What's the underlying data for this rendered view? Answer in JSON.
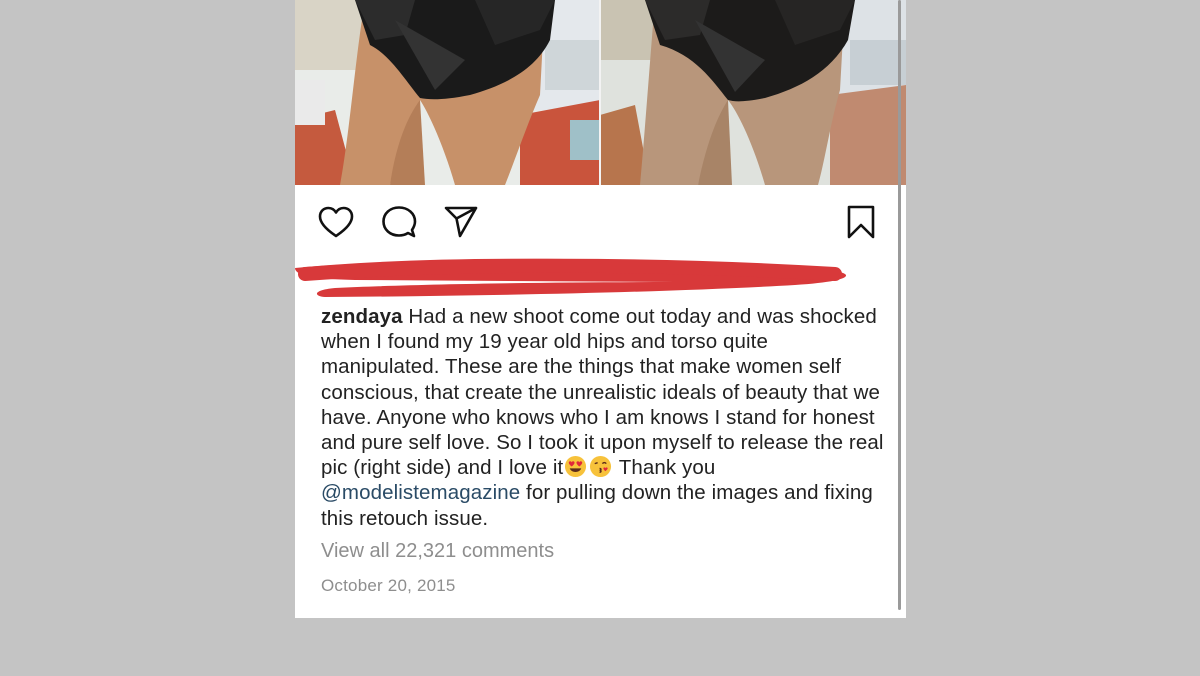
{
  "post": {
    "images": [
      {
        "icon": "edited-photo-image"
      },
      {
        "icon": "original-photo-image"
      }
    ],
    "actions": {
      "like_icon": "heart-icon",
      "comment_icon": "comment-bubble-icon",
      "share_icon": "paper-plane-icon",
      "save_icon": "bookmark-icon"
    },
    "caption": {
      "username": "zendaya",
      "text_part1": "Had a new shoot come out today and was shocked when I found my 19 year old hips and torso quite manipulated. These are the things that make women self conscious, that create the unrealistic ideals of beauty that we have. Anyone who knows who I am knows I stand for honest and pure self love. So I took it upon myself to release the real pic (right side) and I love it",
      "emojis": [
        "😍",
        "😘"
      ],
      "text_part2": " Thank you ",
      "mention": "@modelistemagazine",
      "text_part3": " for pulling down the images and fixing this retouch issue."
    },
    "view_comments": "View all 22,321 comments",
    "date": "October 20, 2015"
  },
  "colors": {
    "background": "#c4c4c4",
    "card": "#ffffff",
    "redaction": "#d8393a",
    "text": "#222222",
    "muted": "#8e8e8e",
    "mention": "#2a4b66"
  }
}
